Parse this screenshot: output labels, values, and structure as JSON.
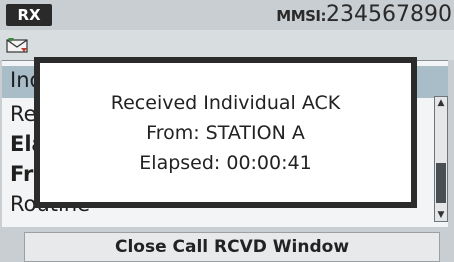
{
  "status_bar": {
    "rx_label": "RX",
    "mmsi_label": "MMSI:",
    "mmsi_value": "234567890"
  },
  "background_window": {
    "title_fragment": "Ind",
    "lines": [
      "Rec",
      "Ela",
      "Fro",
      "Routine"
    ]
  },
  "popup": {
    "line1": "Received Individual ACK",
    "line2": "From: STATION A",
    "line3": "Elapsed: 00:00:41"
  },
  "bottom": {
    "button_label": "Close Call RCVD Window"
  },
  "colors": {
    "accent_title_row": "#a9bdc9",
    "status_badge": "#2a2a2a"
  },
  "icons": {
    "mail": "mail-icon",
    "scroll_up": "scroll-up-icon",
    "scroll_down": "scroll-down-icon"
  }
}
